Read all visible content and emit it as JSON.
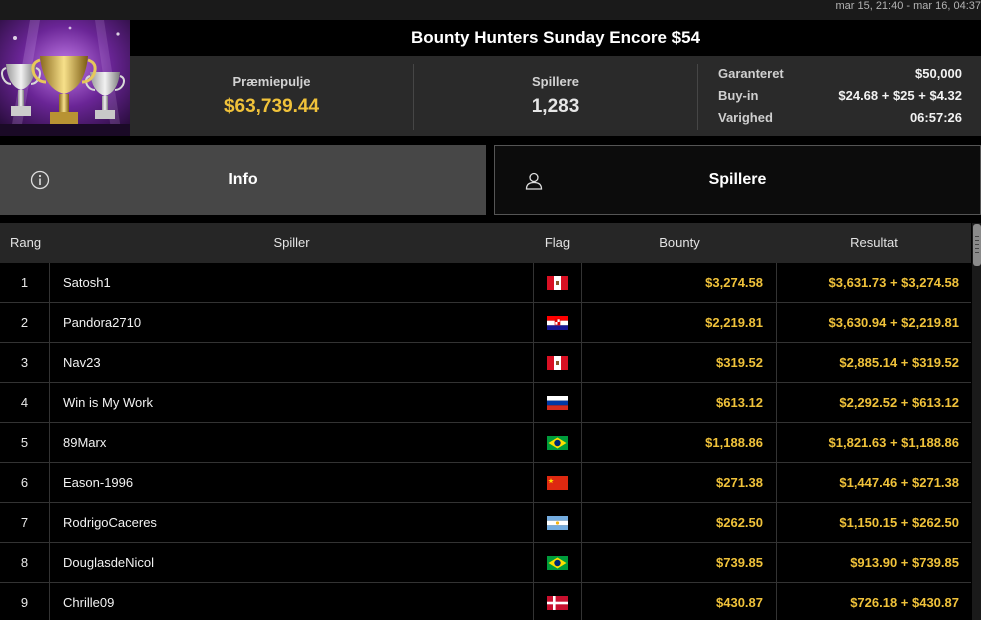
{
  "header": {
    "date_range": "mar 15, 21:40 - mar 16, 04:37",
    "title": "Bounty Hunters Sunday Encore $54"
  },
  "stats": {
    "prize_label": "Præmiepulje",
    "prize_value": "$63,739.44",
    "players_label": "Spillere",
    "players_value": "1,283",
    "details": [
      {
        "key": "Garanteret",
        "value": "$50,000"
      },
      {
        "key": "Buy-in",
        "value": "$24.68 + $25 + $4.32"
      },
      {
        "key": "Varighed",
        "value": "06:57:26"
      }
    ]
  },
  "tabs": {
    "info": {
      "label": "Info",
      "icon": "info-icon"
    },
    "players": {
      "label": "Spillere",
      "icon": "user-icon"
    }
  },
  "table": {
    "headers": {
      "rank": "Rang",
      "player": "Spiller",
      "flag": "Flag",
      "bounty": "Bounty",
      "result": "Resultat"
    },
    "rows": [
      {
        "rank": "1",
        "player": "Satosh1",
        "flag": "peru",
        "bounty": "$3,274.58",
        "result": "$3,631.73 + $3,274.58"
      },
      {
        "rank": "2",
        "player": "Pandora2710",
        "flag": "croatia",
        "bounty": "$2,219.81",
        "result": "$3,630.94 + $2,219.81"
      },
      {
        "rank": "3",
        "player": "Nav23",
        "flag": "peru",
        "bounty": "$319.52",
        "result": "$2,885.14 + $319.52"
      },
      {
        "rank": "4",
        "player": "Win is My Work",
        "flag": "russia",
        "bounty": "$613.12",
        "result": "$2,292.52 + $613.12"
      },
      {
        "rank": "5",
        "player": "89Marx",
        "flag": "brazil",
        "bounty": "$1,188.86",
        "result": "$1,821.63 + $1,188.86"
      },
      {
        "rank": "6",
        "player": "Eason-1996",
        "flag": "china",
        "bounty": "$271.38",
        "result": "$1,447.46 + $271.38"
      },
      {
        "rank": "7",
        "player": "RodrigoCaceres",
        "flag": "argentina",
        "bounty": "$262.50",
        "result": "$1,150.15 + $262.50"
      },
      {
        "rank": "8",
        "player": "DouglasdeNicol",
        "flag": "brazil",
        "bounty": "$739.85",
        "result": "$913.90 + $739.85"
      },
      {
        "rank": "9",
        "player": "Chrille09",
        "flag": "denmark",
        "bounty": "$430.87",
        "result": "$726.18 + $430.87"
      }
    ]
  },
  "colors": {
    "accent_gold": "#f0c23a",
    "tab_active": "#474747",
    "panel": "#2a2a2a"
  }
}
